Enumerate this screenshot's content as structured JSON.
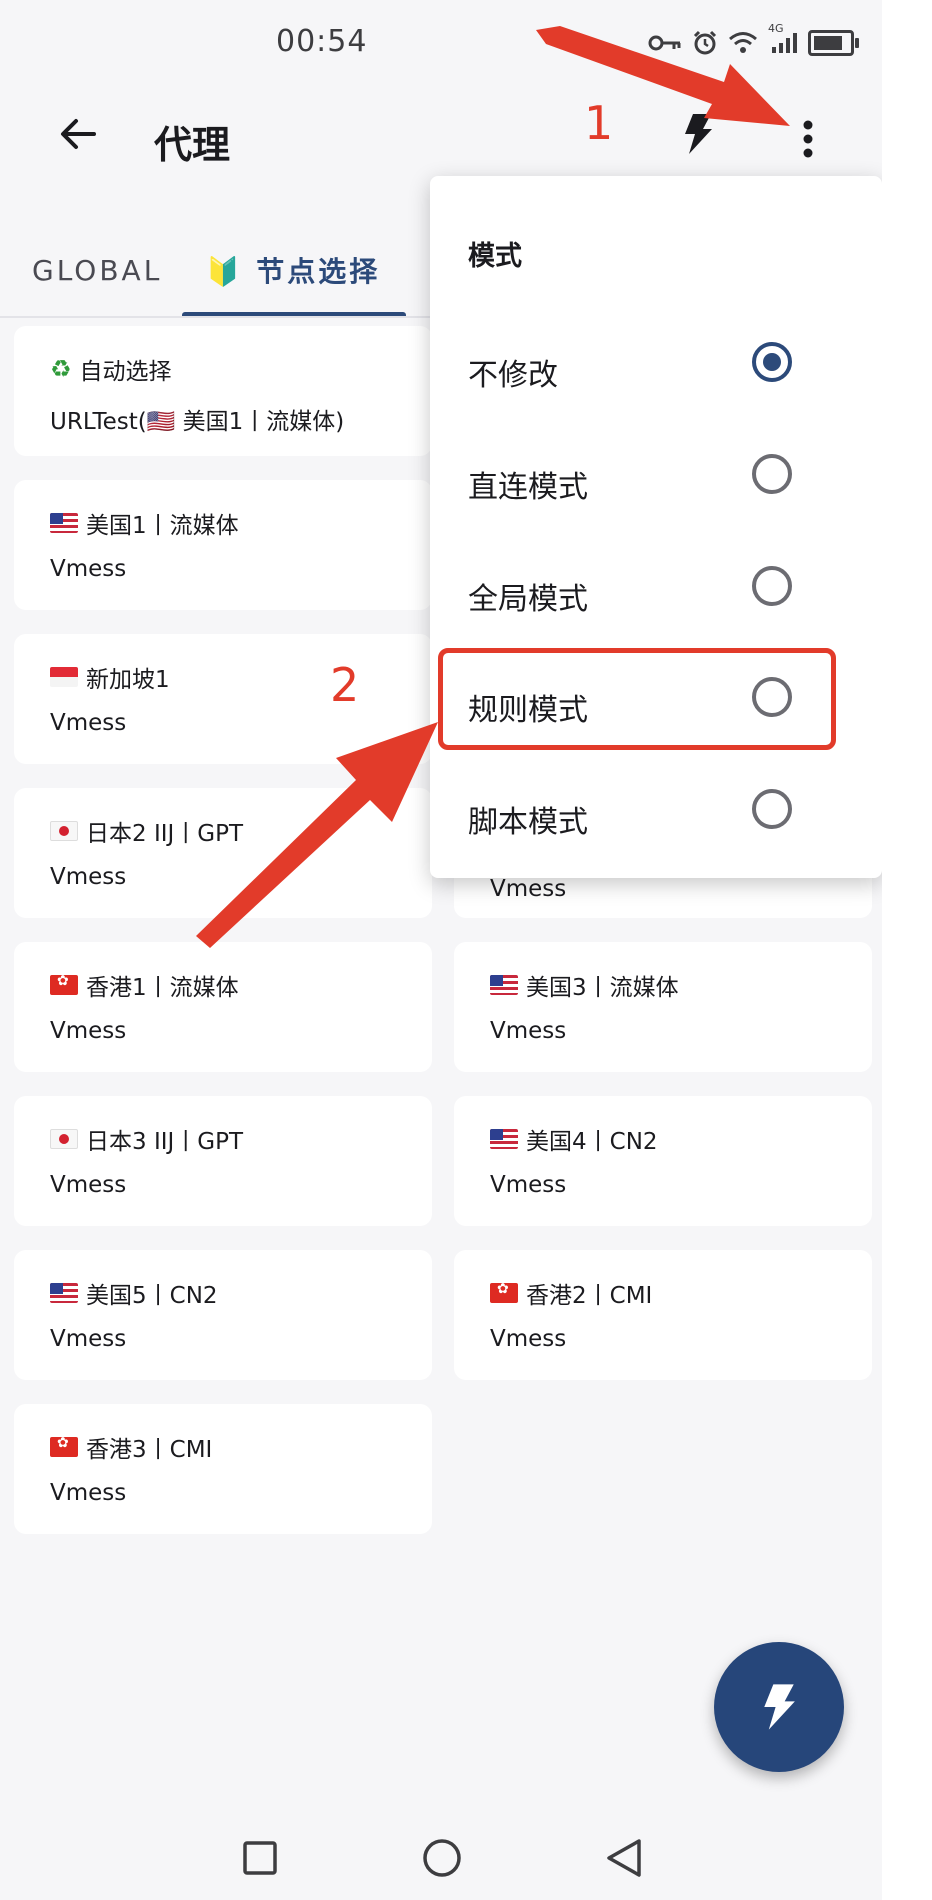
{
  "status_bar": {
    "time": "00:54",
    "icons": [
      "key-icon",
      "alarm-icon",
      "wifi-icon",
      "4g-signal-icon",
      "battery-icon"
    ],
    "network_label": "4G"
  },
  "app_bar": {
    "title": "代理",
    "icons": [
      "back-arrow-icon",
      "flash-icon",
      "more-vert-icon"
    ]
  },
  "tabs": [
    {
      "label": "GLOBAL",
      "active": false
    },
    {
      "label": "🔰 节点选择",
      "active": true
    }
  ],
  "proxies": [
    {
      "flag": "recycle",
      "name": "自动选择",
      "type": "URLTest(🇺🇸 美国1丨流媒体)"
    },
    {
      "flag": "us",
      "name": "美国1丨流媒体",
      "type": "Vmess"
    },
    {
      "flag": "sg",
      "name": "新加坡1",
      "type": "Vmess"
    },
    {
      "flag": "jp",
      "name": "日本2 IIJ丨GPT",
      "type": "Vmess"
    },
    {
      "flag": "hk",
      "name": "香港1丨流媒体",
      "type": "Vmess"
    },
    {
      "flag": "us",
      "name": "美国3丨流媒体",
      "type": "Vmess"
    },
    {
      "flag": "jp",
      "name": "日本3 IIJ丨GPT",
      "type": "Vmess"
    },
    {
      "flag": "us",
      "name": "美国4丨CN2",
      "type": "Vmess"
    },
    {
      "flag": "us",
      "name": "美国5丨CN2",
      "type": "Vmess"
    },
    {
      "flag": "hk",
      "name": "香港2丨CMI",
      "type": "Vmess"
    },
    {
      "flag": "hk",
      "name": "香港3丨CMI",
      "type": "Vmess"
    }
  ],
  "partial_card_text": "Vmess",
  "mode_menu": {
    "title": "模式",
    "options": [
      {
        "label": "不修改",
        "selected": true
      },
      {
        "label": "直连模式",
        "selected": false
      },
      {
        "label": "全局模式",
        "selected": false
      },
      {
        "label": "规则模式",
        "selected": false
      },
      {
        "label": "脚本模式",
        "selected": false
      }
    ]
  },
  "annotations": {
    "step1": "1",
    "step2": "2",
    "color": "#e23b2a"
  },
  "colors": {
    "primary": "#2c4a7a",
    "fab": "#26467a",
    "background": "#f6f6f8"
  }
}
